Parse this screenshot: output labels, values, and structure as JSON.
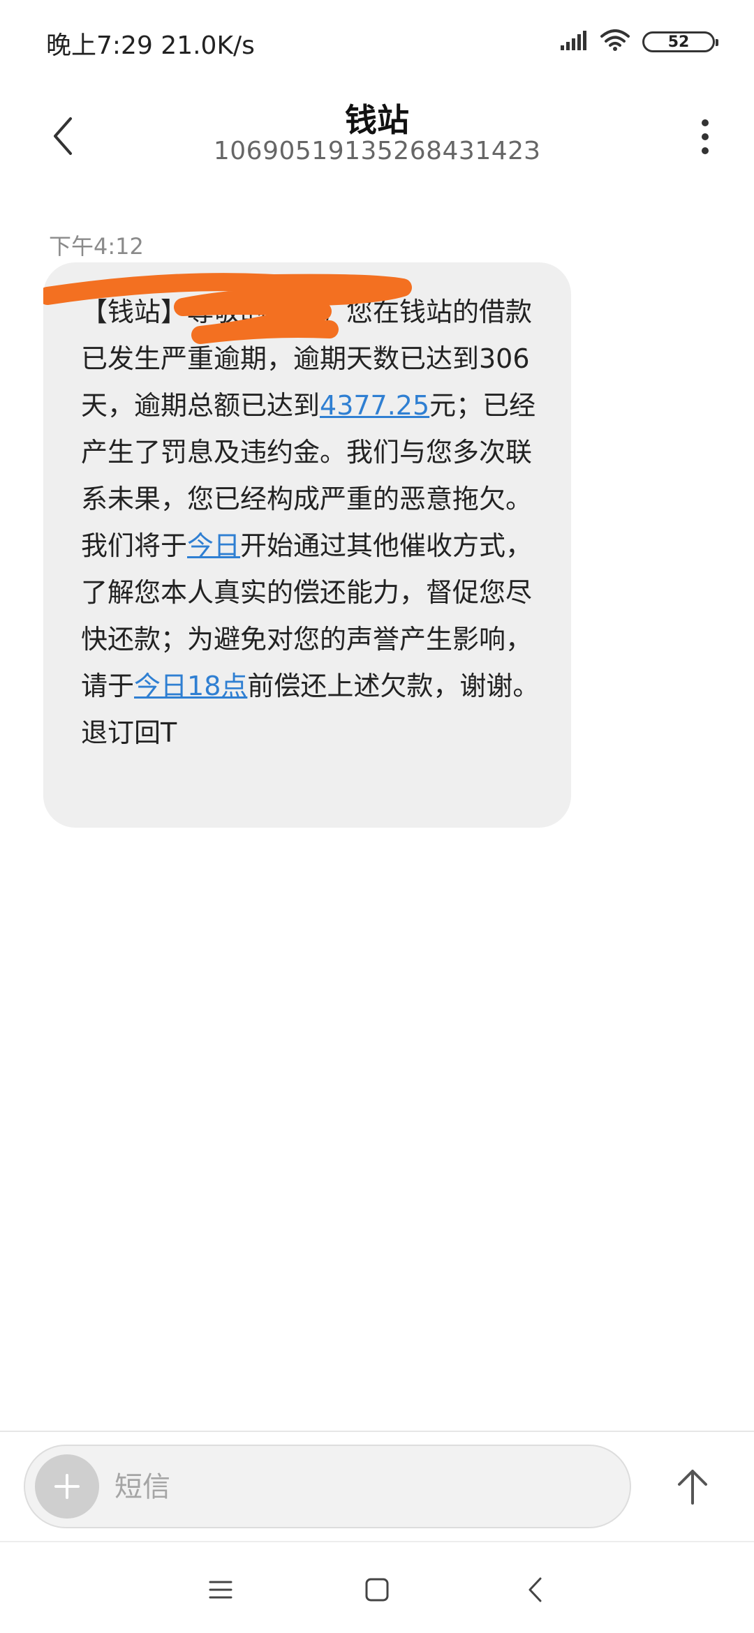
{
  "status_bar": {
    "time_speed": "晚上7:29 21.0K/s",
    "battery_level": "52",
    "icons": [
      "signal-icon",
      "wifi-icon",
      "battery-icon"
    ]
  },
  "header": {
    "title": "钱站",
    "phone_number": "1069051913526843142З"
  },
  "message": {
    "timestamp": "下午4:12",
    "text_part1": "【钱站】尊敬的用户，您在钱站的借款已发生严重逾期，逾期天数已达到306天，逾期总额已达到",
    "amount_link": "4377.25",
    "text_part2": "元；已经产生了罚息及违约金。我们与您多次联系未果，您已经构成严重的恶意拖欠。我们将于",
    "today_link": "今日",
    "text_part3": "开始通过其他催收方式，了解您本人真实的偿还能力，督促您尽快还款；为避免对您的声誉产生影响，请于",
    "deadline_link": "今日18点",
    "text_part4": "前偿还上述欠款，谢谢。退订回T",
    "redaction_color": "#f37021"
  },
  "compose": {
    "placeholder": "短信"
  },
  "colors": {
    "link": "#2f7fd2",
    "bubble": "#efefef"
  }
}
